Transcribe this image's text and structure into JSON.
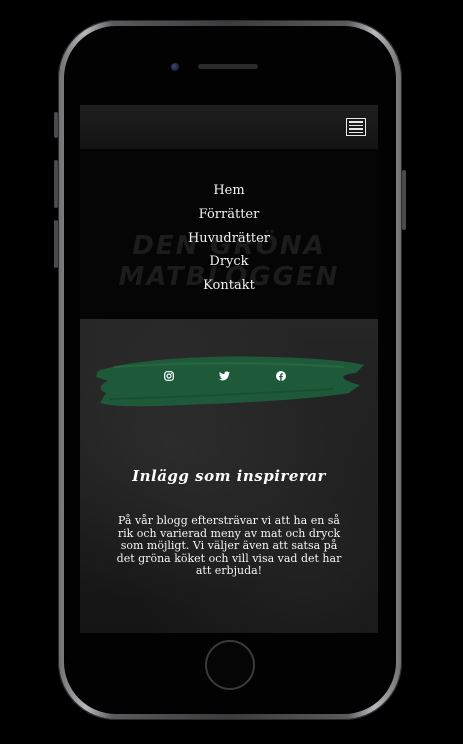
{
  "nav": {
    "items": [
      {
        "label": "Hem"
      },
      {
        "label": "Förrätter"
      },
      {
        "label": "Huvudrätter"
      },
      {
        "label": "Dryck"
      },
      {
        "label": "Kontakt"
      }
    ],
    "menu_icon": "hamburger-menu-icon"
  },
  "hero": {
    "title_line1": "Den gröna",
    "title_line2": "matbloggen"
  },
  "social": {
    "icons": [
      "instagram-icon",
      "twitter-icon",
      "facebook-icon"
    ],
    "brush_color": "#1e5a3a"
  },
  "section": {
    "title": "Inlägg som inspirerar",
    "text": "På vår blogg eftersträvar vi att ha en så rik och varierad meny av mat och dryck som möjligt. Vi väljer även att satsa på det gröna köket och vill visa vad det har att erbjuda!"
  },
  "colors": {
    "background": "#000000",
    "accent": "#1e5a3a",
    "text": "#ffffff"
  }
}
